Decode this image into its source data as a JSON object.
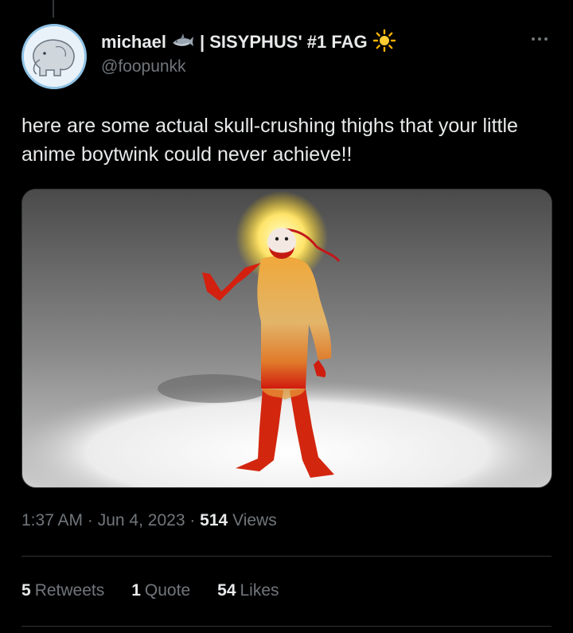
{
  "author": {
    "display_name": "michael",
    "display_tag": "| SISYPHUS' #1 FAG",
    "handle": "@foopunkk",
    "badge_icons": [
      "shark-icon",
      "sun-icon"
    ]
  },
  "tweet": {
    "text": "here are some actual skull-crushing thighs that your little anime boytwink could never achieve!!",
    "time": "1:37 AM",
    "date": "Jun 4, 2023",
    "views_count": "514",
    "views_label": "Views"
  },
  "stats": {
    "retweets_count": "5",
    "retweets_label": "Retweets",
    "quotes_count": "1",
    "quotes_label": "Quote",
    "likes_count": "54",
    "likes_label": "Likes"
  },
  "colors": {
    "background": "#000000",
    "text_primary": "#e7e9ea",
    "text_secondary": "#71767b",
    "divider": "#2f3336"
  }
}
